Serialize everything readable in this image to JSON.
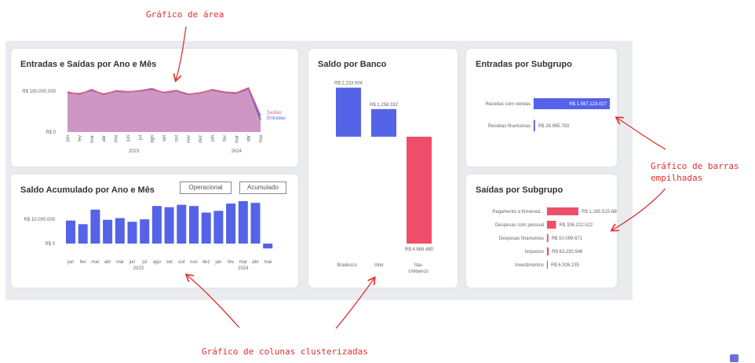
{
  "annotations": {
    "area": "Gráfico de área",
    "stacked": [
      "Gráfico de barras",
      "empilhadas"
    ],
    "clustered": "Gráfico de colunas clusterizadas"
  },
  "cards": {
    "entradas_saidas": "Entradas e Saídas por Ano e Mês",
    "saldo_acumulado": "Saldo Acumulado por Ano e Mês",
    "saldo_banco": "Saldo por Banco",
    "entradas_subgrupo": "Entradas por Subgrupo",
    "saidas_subgrupo": "Saídas por Subgrupo"
  },
  "buttons": {
    "operacional": "Operacional",
    "acumulado": "Acumulado"
  },
  "colors": {
    "saidas": "#e8607b",
    "entradas": "#5563e8",
    "area_fill": "#c98bbb",
    "bar_blue": "#5563e8",
    "bar_red": "#ef4e6a"
  },
  "chart_data": [
    {
      "type": "area",
      "title": "Entradas e Saídas por Ano e Mês",
      "months": [
        "jan",
        "fev",
        "mar",
        "abr",
        "mai",
        "jun",
        "jul",
        "ago",
        "set",
        "out",
        "nov",
        "dez",
        "jan",
        "fev",
        "mar",
        "abr",
        "mai"
      ],
      "years": [
        "2023",
        "2024"
      ],
      "yticks": [
        "R$ 100.000.000",
        "R$ 0"
      ],
      "ylim": [
        0,
        150000000
      ],
      "series": [
        {
          "name": "Saídas",
          "values": [
            98000000,
            92000000,
            104000000,
            91000000,
            101000000,
            99000000,
            100000000,
            104000000,
            97000000,
            102000000,
            93000000,
            95000000,
            104000000,
            98000000,
            96000000,
            108000000,
            40000000
          ]
        },
        {
          "name": "Entradas",
          "values": [
            96000000,
            94000000,
            102000000,
            93000000,
            100000000,
            98000000,
            101000000,
            106000000,
            96000000,
            101000000,
            92000000,
            96000000,
            103000000,
            97000000,
            95000000,
            106000000,
            30000000
          ]
        }
      ]
    },
    {
      "type": "bar",
      "title": "Saldo Acumulado por Ano e Mês",
      "months": [
        "jan",
        "fev",
        "mar",
        "abr",
        "mai",
        "jun",
        "jul",
        "ago",
        "set",
        "out",
        "nov",
        "dez",
        "jan",
        "fev",
        "mar",
        "abr",
        "mai"
      ],
      "years": [
        "2023",
        "2024"
      ],
      "yticks": [
        "R$ 10.000.000",
        "R$ 0"
      ],
      "ylim": [
        -1000000,
        16000000
      ],
      "values": [
        9500000,
        8000000,
        14000000,
        9800000,
        10500000,
        9000000,
        10000000,
        15500000,
        15000000,
        16000000,
        15500000,
        12800000,
        13500000,
        16500000,
        17500000,
        16800000,
        -2000000
      ]
    },
    {
      "type": "bar",
      "title": "Saldo por Banco",
      "categories": [
        "Bradesco",
        "Inter",
        "Itau Unibanco"
      ],
      "values": [
        2233904,
        1258332,
        -4868480
      ],
      "labels": [
        "R$ 2.233.904",
        "R$ 1.258.332",
        "R$ 4.868.480"
      ]
    },
    {
      "type": "bar",
      "title": "Entradas por Subgrupo",
      "categories": [
        "Receitas com vendas",
        "Receitas financeiras"
      ],
      "values": [
        1567123027,
        28995783
      ],
      "labels": [
        "R$ 1.567.123.027",
        "R$ 28.995.783"
      ]
    },
    {
      "type": "bar",
      "title": "Saídas por Subgrupo",
      "categories": [
        "Pagamento a forneced...",
        "Despesas com pessoal",
        "Despesas financeiras",
        "Impostos",
        "Investimentos"
      ],
      "values": [
        1165515680,
        336222522,
        50099671,
        63230946,
        6926235
      ],
      "labels": [
        "R$ 1.165.515.680",
        "R$ 336.222.522",
        "R$ 50.099.671",
        "R$ 63.230.946",
        "R$ 6.926.235"
      ]
    }
  ]
}
